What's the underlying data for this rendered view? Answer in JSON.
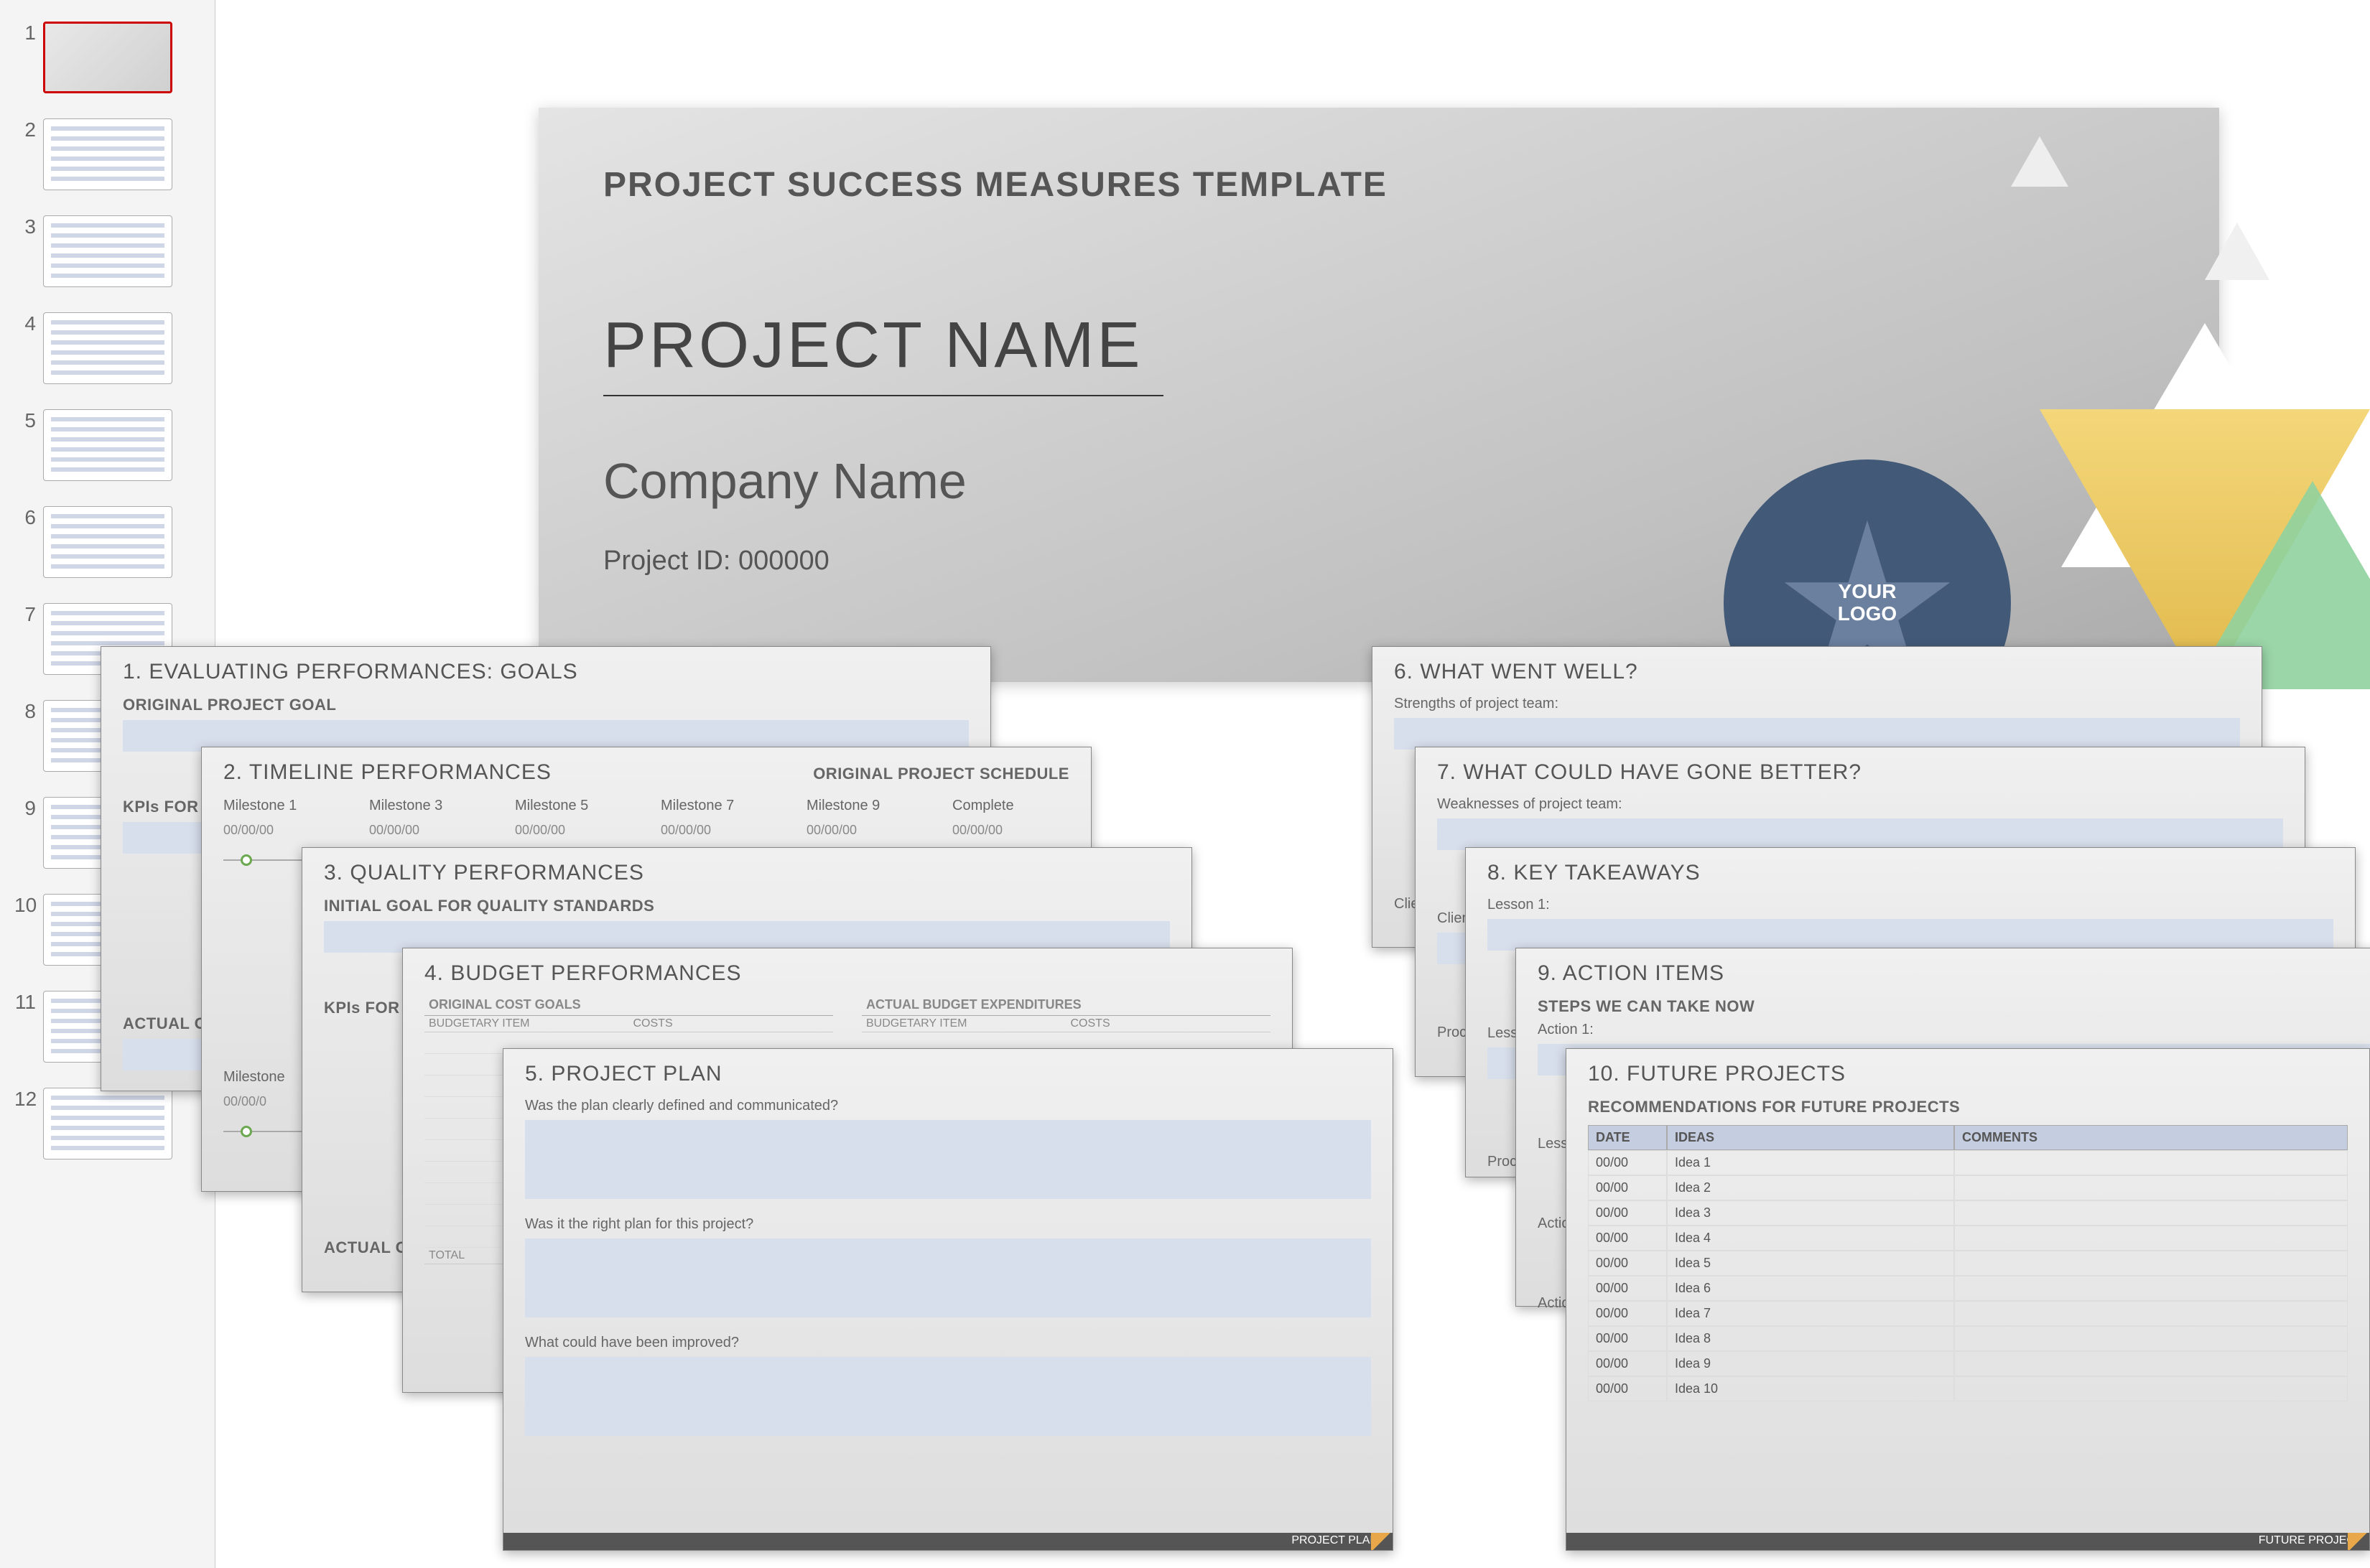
{
  "thumbnails": [
    {
      "num": "1",
      "selected": true
    },
    {
      "num": "2"
    },
    {
      "num": "3"
    },
    {
      "num": "4"
    },
    {
      "num": "5"
    },
    {
      "num": "6"
    },
    {
      "num": "7"
    },
    {
      "num": "8"
    },
    {
      "num": "9"
    },
    {
      "num": "10"
    },
    {
      "num": "11"
    },
    {
      "num": "12"
    }
  ],
  "main": {
    "template_title": "PROJECT SUCCESS MEASURES TEMPLATE",
    "project_name": "PROJECT NAME",
    "company_name": "Company Name",
    "project_id": "Project ID:  000000",
    "logo_text": "YOUR LOGO"
  },
  "cards_left": [
    {
      "title": "1. EVALUATING PERFORMANCES: GOALS",
      "sub1": "ORIGINAL PROJECT GOAL",
      "sub2": "KPIs FOR MEA",
      "sub3": "ACTUAL OUT"
    },
    {
      "title": "2. TIMELINE PERFORMANCES",
      "right_title": "ORIGINAL PROJECT SCHEDULE",
      "milestones": [
        {
          "name": "Milestone 1",
          "date": "00/00/00"
        },
        {
          "name": "Milestone 3",
          "date": "00/00/00"
        },
        {
          "name": "Milestone 5",
          "date": "00/00/00"
        },
        {
          "name": "Milestone 7",
          "date": "00/00/00"
        },
        {
          "name": "Milestone 9",
          "date": "00/00/00"
        },
        {
          "name": "Complete",
          "date": "00/00/00"
        }
      ],
      "bottom_ms": {
        "name": "Milestone",
        "date": "00/00/0"
      }
    },
    {
      "title": "3. QUALITY PERFORMANCES",
      "sub1": "INITIAL GOAL FOR QUALITY STANDARDS",
      "sub2": "KPIs FOR MEA",
      "sub3": "ACTUAL OUT"
    },
    {
      "title": "4. BUDGET PERFORMANCES",
      "left_hdr": "ORIGINAL COST GOALS",
      "right_hdr": "ACTUAL BUDGET EXPENDITURES",
      "col1": "BUDGETARY ITEM",
      "col2": "COSTS",
      "total": "TOTAL"
    },
    {
      "title": "5. PROJECT PLAN",
      "q1": "Was the plan clearly defined and communicated?",
      "q2": "Was it the right plan for this project?",
      "q3": "What could have been improved?",
      "footer": "PROJECT PLAN"
    }
  ],
  "cards_right": [
    {
      "title": "6. WHAT WENT WELL?",
      "sub": "Strengths of project team:",
      "l2": "Clie"
    },
    {
      "title": "7. WHAT COULD HAVE GONE BETTER?",
      "sub": "Weaknesses of project team:",
      "l2": "Client re",
      "l3": "Proc"
    },
    {
      "title": "8. KEY TAKEAWAYS",
      "sub": "Lesson 1:",
      "l2": "Lesson",
      "l3": "Processe"
    },
    {
      "title": "9. ACTION ITEMS",
      "sub": "STEPS WE CAN TAKE NOW",
      "l1": "Action 1:",
      "l2": "Lesson",
      "l3": "Action",
      "l4": "Action"
    },
    {
      "title": "10. FUTURE PROJECTS",
      "sub": "RECOMMENDATIONS FOR FUTURE PROJECTS",
      "hdr": {
        "date": "DATE",
        "ideas": "IDEAS",
        "comments": "COMMENTS"
      },
      "rows": [
        {
          "date": "00/00",
          "idea": "Idea 1"
        },
        {
          "date": "00/00",
          "idea": "Idea 2"
        },
        {
          "date": "00/00",
          "idea": "Idea 3"
        },
        {
          "date": "00/00",
          "idea": "Idea 4"
        },
        {
          "date": "00/00",
          "idea": "Idea 5"
        },
        {
          "date": "00/00",
          "idea": "Idea 6"
        },
        {
          "date": "00/00",
          "idea": "Idea 7"
        },
        {
          "date": "00/00",
          "idea": "Idea 8"
        },
        {
          "date": "00/00",
          "idea": "Idea 9"
        },
        {
          "date": "00/00",
          "idea": "Idea 10"
        }
      ],
      "footer": "FUTURE PROJEC"
    }
  ]
}
